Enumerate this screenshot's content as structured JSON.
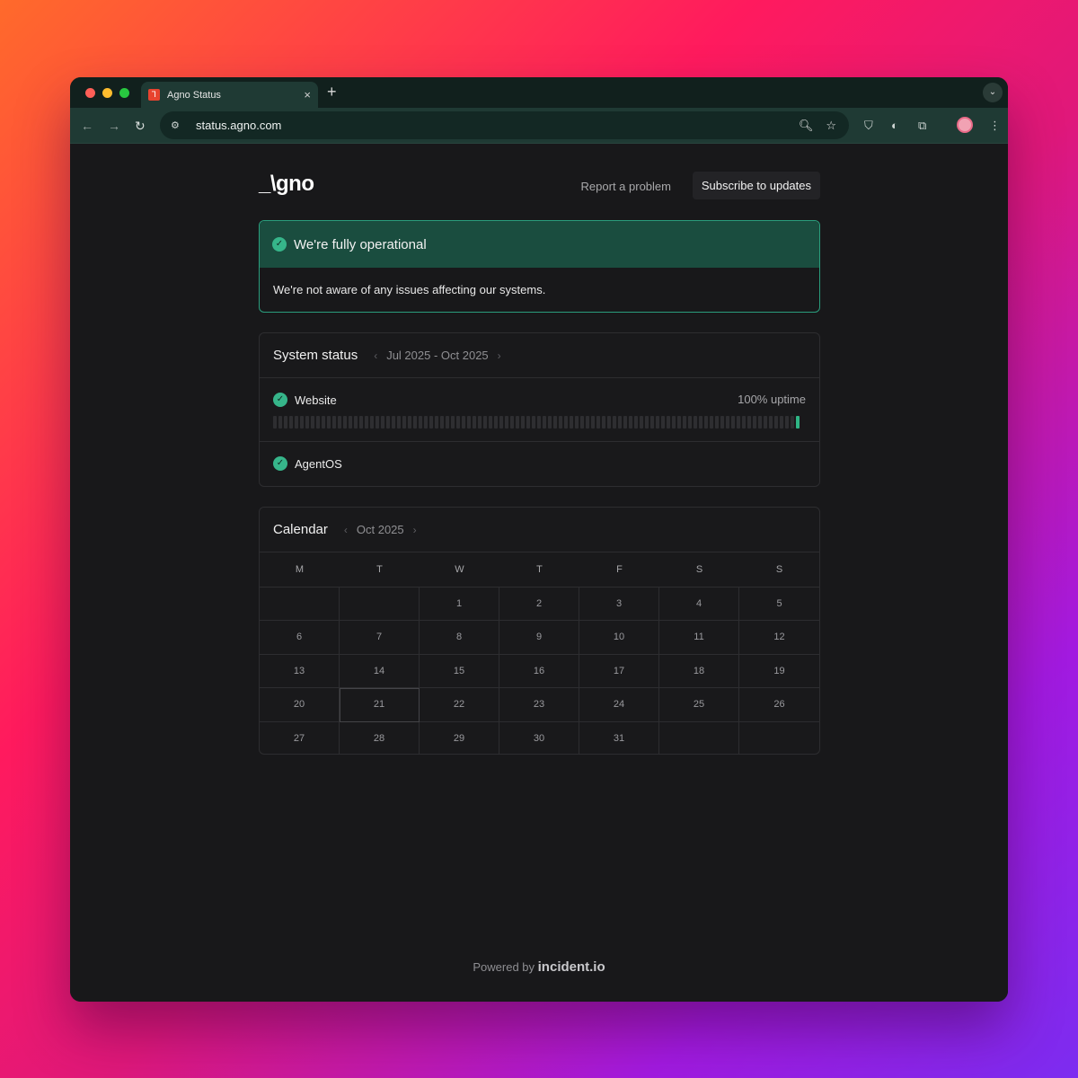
{
  "browser": {
    "tab_title": "Agno Status",
    "tab_close": "×",
    "new_tab": "+",
    "url": "status.agno.com"
  },
  "header": {
    "logo": "_\\gno",
    "report_label": "Report a problem",
    "subscribe_label": "Subscribe to updates"
  },
  "banner": {
    "title": "We're fully operational",
    "body": "We're not aware of any issues affecting our systems.",
    "accent": "#2a9d7c"
  },
  "system_status": {
    "title": "System status",
    "range": "Jul 2025 - Oct 2025",
    "services": [
      {
        "name": "Website",
        "uptime": "100% uptime",
        "status": "operational"
      },
      {
        "name": "AgentOS",
        "status": "operational"
      }
    ]
  },
  "calendar": {
    "title": "Calendar",
    "month": "Oct 2025",
    "weekdays": [
      "M",
      "T",
      "W",
      "T",
      "F",
      "S",
      "S"
    ],
    "days": [
      "",
      "",
      "1",
      "2",
      "3",
      "4",
      "5",
      "6",
      "7",
      "8",
      "9",
      "10",
      "11",
      "12",
      "13",
      "14",
      "15",
      "16",
      "17",
      "18",
      "19",
      "20",
      "21",
      "22",
      "23",
      "24",
      "25",
      "26",
      "27",
      "28",
      "29",
      "30",
      "31",
      "",
      ""
    ],
    "today": "21"
  },
  "footer": {
    "prefix": "Powered by",
    "brand": "incident.io"
  },
  "colors": {
    "operational": "#36b58a",
    "background": "#18181a"
  }
}
